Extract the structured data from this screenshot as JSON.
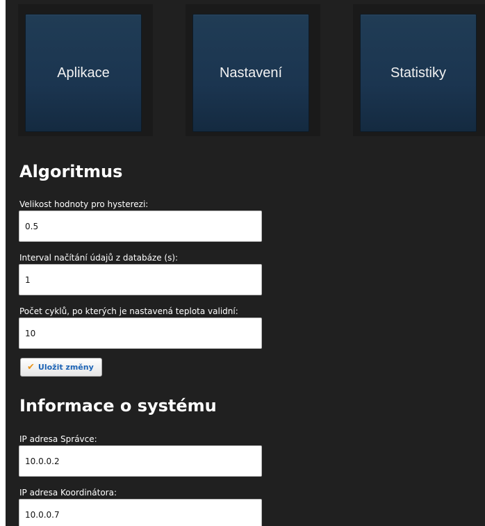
{
  "nav": {
    "tiles": [
      {
        "label": "Aplikace"
      },
      {
        "label": "Nastavení"
      },
      {
        "label": "Statistiky"
      }
    ]
  },
  "algorithm": {
    "heading": "Algoritmus",
    "fields": [
      {
        "label": "Velikost hodnoty pro hysterezi:",
        "value": "0.5"
      },
      {
        "label": "Interval načítání údajů z databáze (s):",
        "value": "1"
      },
      {
        "label": "Počet cyklů, po kterých je nastavená teplota validní:",
        "value": "10"
      }
    ],
    "save_label": "Uložit změny"
  },
  "system_info": {
    "heading": "Informace o systému",
    "fields": [
      {
        "label": "IP adresa Správce:",
        "value": "10.0.0.2"
      },
      {
        "label": "IP adresa Koordinátora:",
        "value": "10.0.0.7"
      }
    ]
  },
  "icons": {
    "save": "check-icon"
  },
  "colors": {
    "background": "#202020",
    "tile": "#1b3550",
    "button_text": "#1c63b5",
    "check": "#e8941a"
  }
}
